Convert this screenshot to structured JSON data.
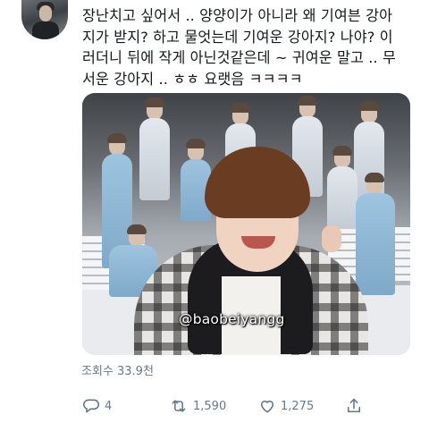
{
  "tweet": {
    "text": "장난치고 싶어서 .. 양양이가 아니라 왜 기여븐 강아\n지가 받지? 하고 물엇는데 기여운 강아지? 나야? 이\n러더니 뒤에 작게 아닌것같은데 ~ 귀여운 말고 .. 무\n서운 강아지 .. ㅎㅎ 요랫음 ㅋㅋㅋㅋ"
  },
  "media": {
    "watermark": "@baobeiyangg"
  },
  "stats": {
    "views": "조회수 33.9천"
  },
  "actions": {
    "reply": {
      "icon": "reply-icon",
      "count": "4"
    },
    "retweet": {
      "icon": "retweet-icon",
      "count": "1,590"
    },
    "like": {
      "icon": "heart-icon",
      "count": "1,275"
    },
    "share": {
      "icon": "share-icon"
    }
  },
  "colors": {
    "text": "#14171a",
    "secondary": "#657786"
  }
}
